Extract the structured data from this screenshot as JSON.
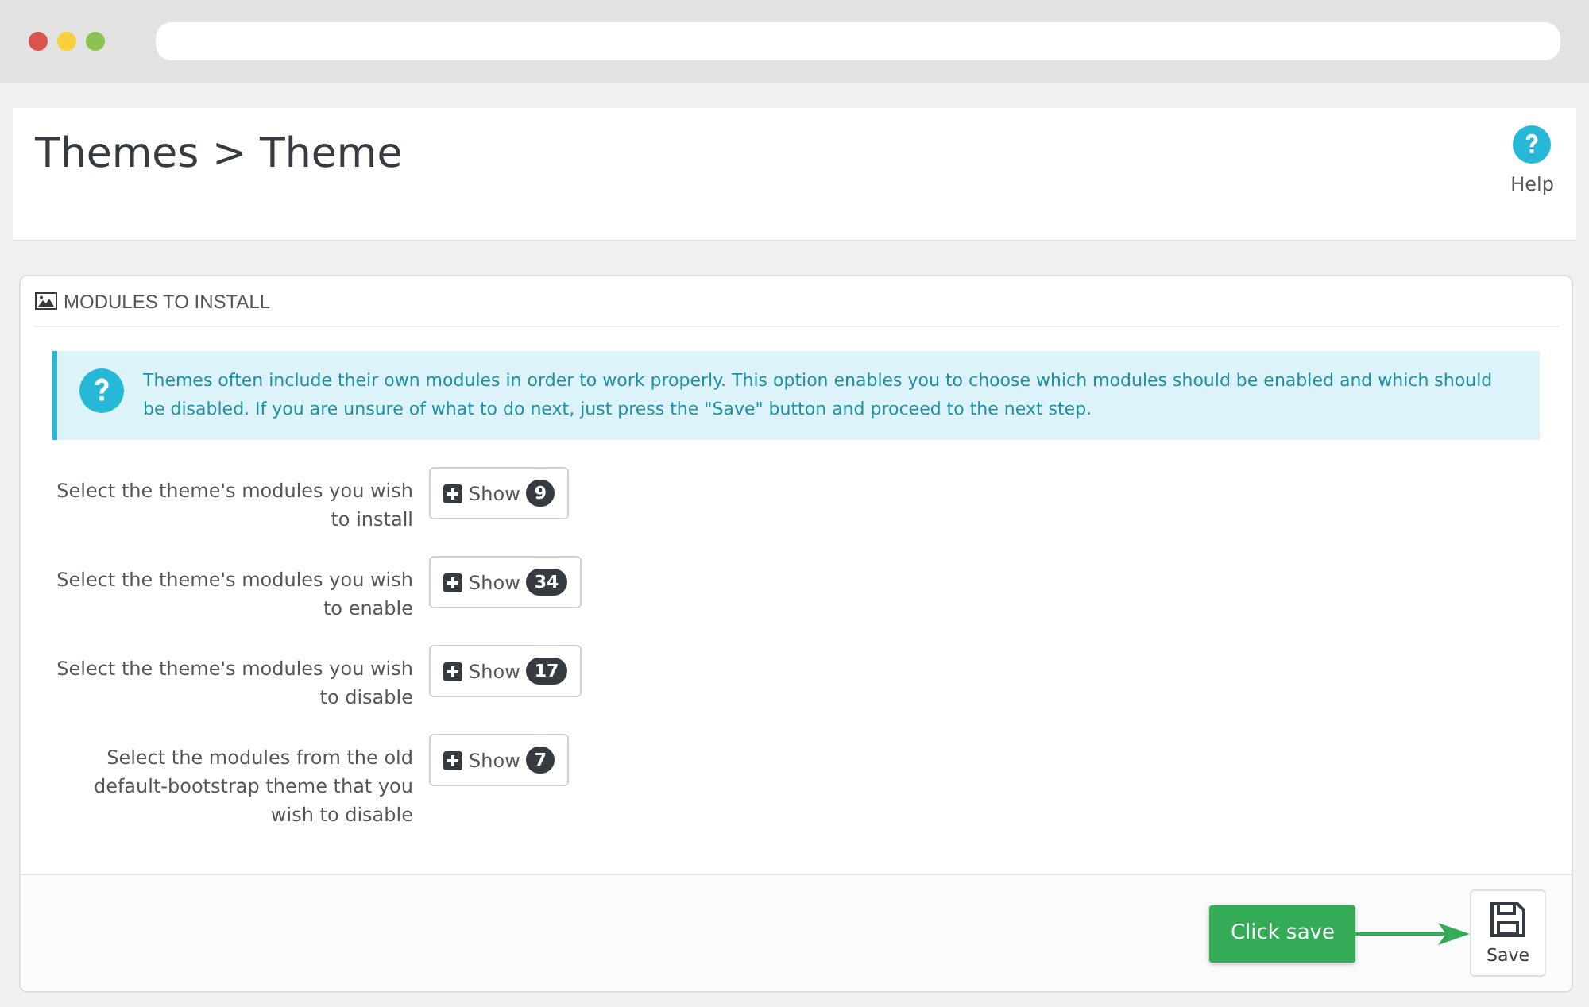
{
  "header": {
    "title": "Themes > Theme",
    "help_label": "Help"
  },
  "panel": {
    "title": "MODULES TO INSTALL",
    "alert": "Themes often include their own modules in order to work properly. This option enables you to choose which modules should be enabled and which should be disabled. If you are unsure of what to do next, just press the \"Save\" button and proceed to the next step.",
    "rows": [
      {
        "label": "Select the theme's modules you wish to install",
        "button": "Show",
        "count": "9"
      },
      {
        "label": "Select the theme's modules you wish to enable",
        "button": "Show",
        "count": "34"
      },
      {
        "label": "Select the theme's modules you wish to disable",
        "button": "Show",
        "count": "17"
      },
      {
        "label": "Select the modules from the old default-bootstrap theme that you wish to disable",
        "button": "Show",
        "count": "7"
      }
    ],
    "callout": "Click save",
    "save_button": "Save"
  }
}
